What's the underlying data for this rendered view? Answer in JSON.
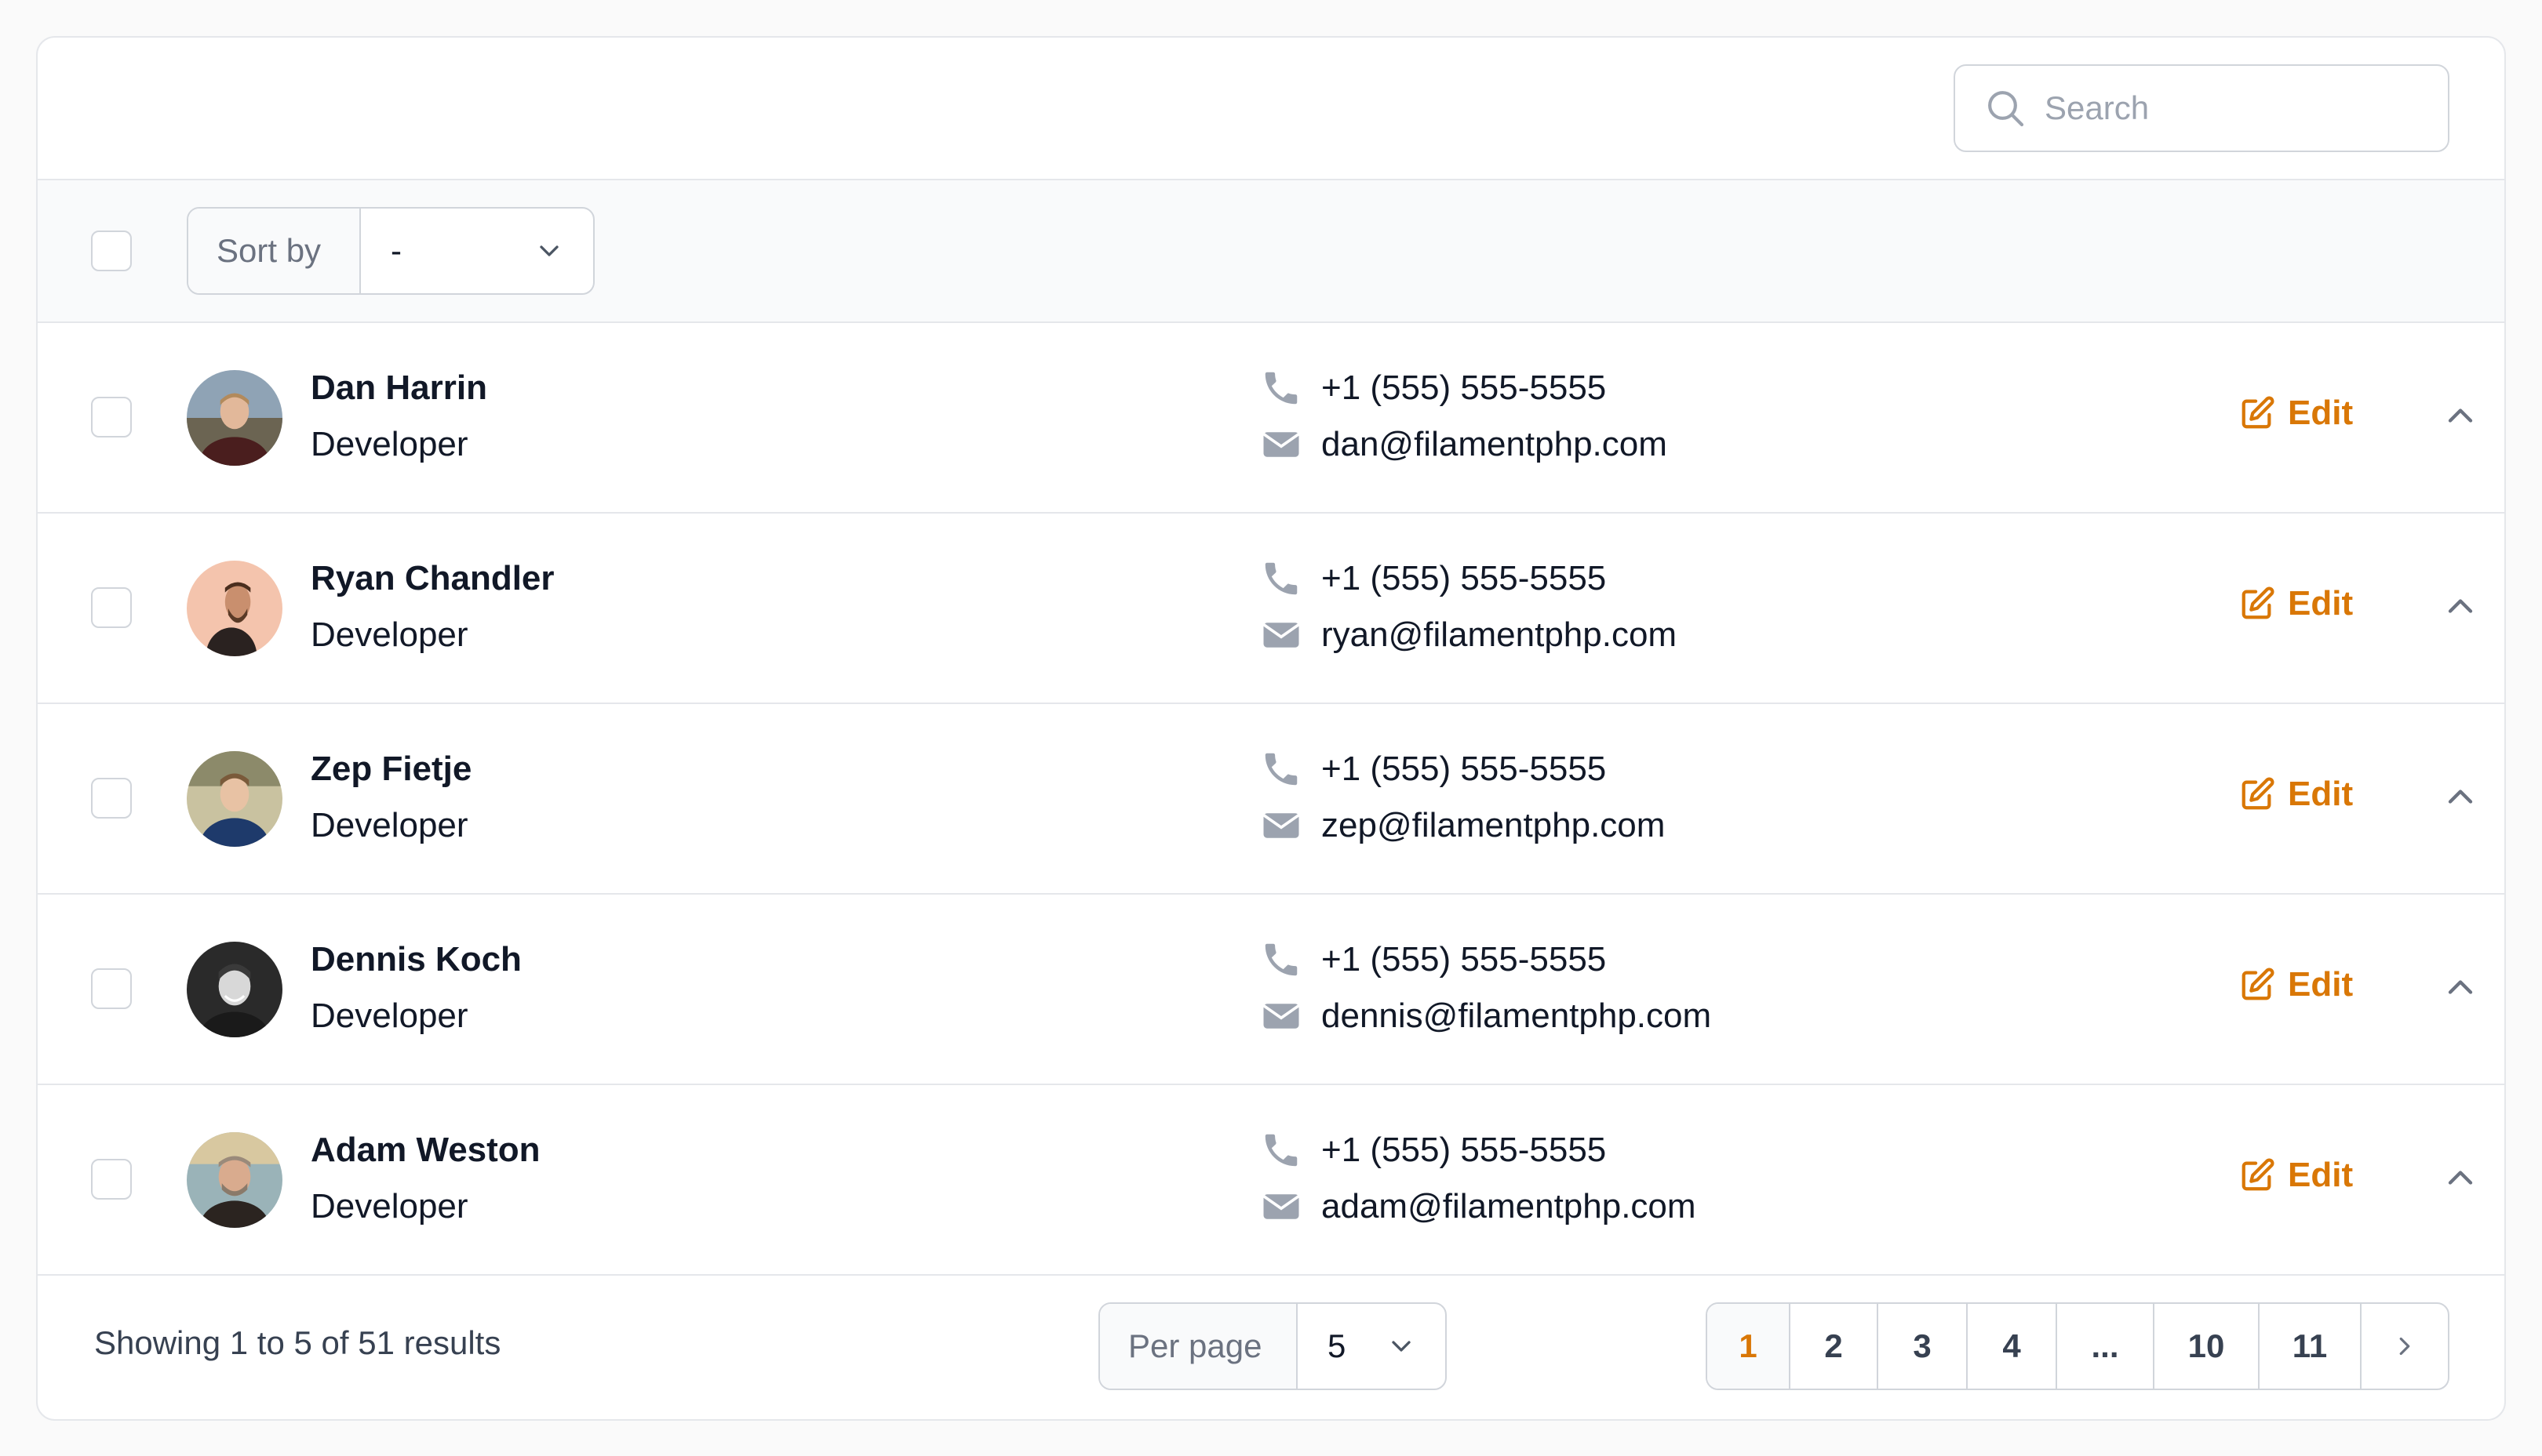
{
  "search": {
    "placeholder": "Search"
  },
  "toolbar": {
    "sort_label": "Sort by",
    "sort_value": "-"
  },
  "rows": [
    {
      "name": "Dan Harrin",
      "role": "Developer",
      "phone": "+1 (555) 555-5555",
      "email": "dan@filamentphp.com",
      "edit_label": "Edit"
    },
    {
      "name": "Ryan Chandler",
      "role": "Developer",
      "phone": "+1 (555) 555-5555",
      "email": "ryan@filamentphp.com",
      "edit_label": "Edit"
    },
    {
      "name": "Zep Fietje",
      "role": "Developer",
      "phone": "+1 (555) 555-5555",
      "email": "zep@filamentphp.com",
      "edit_label": "Edit"
    },
    {
      "name": "Dennis Koch",
      "role": "Developer",
      "phone": "+1 (555) 555-5555",
      "email": "dennis@filamentphp.com",
      "edit_label": "Edit"
    },
    {
      "name": "Adam Weston",
      "role": "Developer",
      "phone": "+1 (555) 555-5555",
      "email": "adam@filamentphp.com",
      "edit_label": "Edit"
    }
  ],
  "footer": {
    "results_text": "Showing 1 to 5 of 51 results",
    "per_page_label": "Per page",
    "per_page_value": "5",
    "pages": [
      "1",
      "2",
      "3",
      "4",
      "...",
      "10",
      "11"
    ],
    "active_page": "1"
  },
  "icons": {
    "search": "search-icon",
    "chevron_down": "chevron-down-icon",
    "phone": "phone-icon",
    "email": "envelope-icon",
    "edit": "pencil-square-icon",
    "collapse": "chevron-up-icon",
    "next": "chevron-right-icon"
  },
  "colors": {
    "accent": "#d97706",
    "border": "#e5e7eb",
    "muted": "#9ca3af",
    "text": "#111827"
  }
}
